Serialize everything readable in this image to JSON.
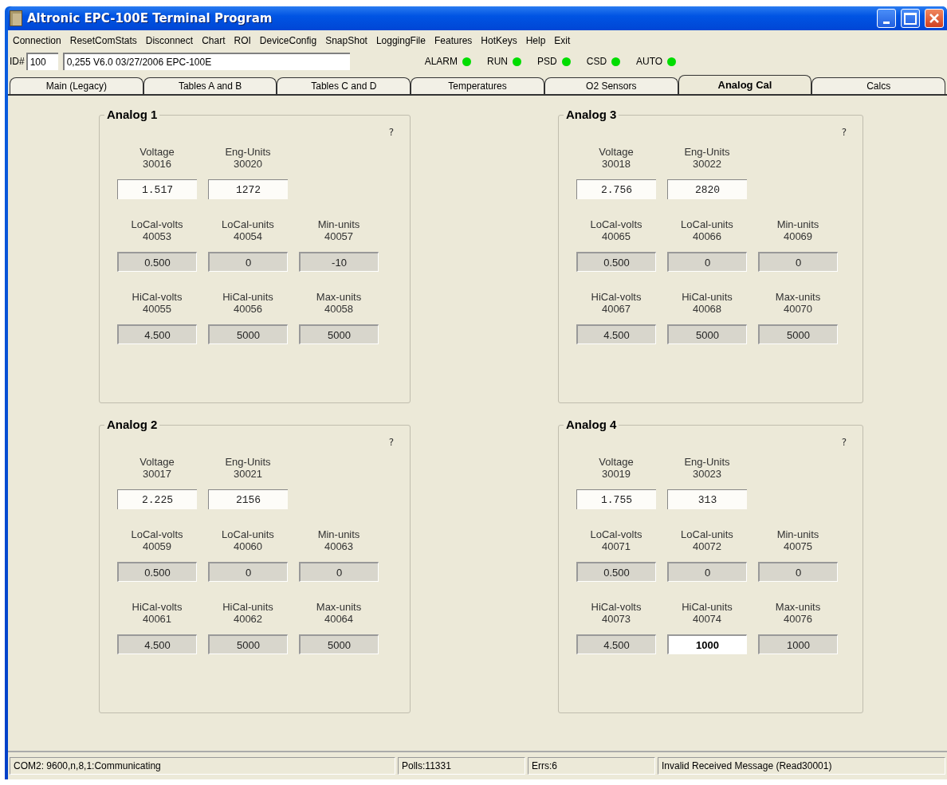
{
  "window": {
    "title": "Altronic EPC-100E Terminal Program"
  },
  "menu": [
    "Connection",
    "ResetComStats",
    "Disconnect",
    "Chart",
    "ROI",
    "DeviceConfig",
    "SnapShot",
    "LoggingFile",
    "Features",
    "HotKeys",
    "Help",
    "Exit"
  ],
  "id_row": {
    "label": "ID#",
    "id_value": "100",
    "device_info": "0,255 V6.0 03/27/2006 EPC-100E"
  },
  "indicators": [
    {
      "label": "ALARM",
      "on": true
    },
    {
      "label": "RUN",
      "on": true
    },
    {
      "label": "PSD",
      "on": true
    },
    {
      "label": "CSD",
      "on": true
    },
    {
      "label": "AUTO",
      "on": true
    }
  ],
  "tabs": [
    {
      "label": "Main (Legacy)",
      "selected": false
    },
    {
      "label": "Tables A and B",
      "selected": false
    },
    {
      "label": "Tables C and D",
      "selected": false
    },
    {
      "label": "Temperatures",
      "selected": false
    },
    {
      "label": "O2 Sensors",
      "selected": false
    },
    {
      "label": "Analog Cal",
      "selected": true
    },
    {
      "label": "Calcs",
      "selected": false
    }
  ],
  "groups": [
    {
      "title": "Analog 1",
      "help": "?",
      "readouts": [
        {
          "label": "Voltage",
          "register": "30016",
          "value": "1.517"
        },
        {
          "label": "Eng-Units",
          "register": "30020",
          "value": "1272"
        }
      ],
      "settings": [
        [
          {
            "label": "LoCal-volts",
            "register": "40053",
            "value": "0.500",
            "focused": false
          },
          {
            "label": "LoCal-units",
            "register": "40054",
            "value": "0",
            "focused": false
          },
          {
            "label": "Min-units",
            "register": "40057",
            "value": "-10",
            "focused": false
          }
        ],
        [
          {
            "label": "HiCal-volts",
            "register": "40055",
            "value": "4.500",
            "focused": false
          },
          {
            "label": "HiCal-units",
            "register": "40056",
            "value": "5000",
            "focused": false
          },
          {
            "label": "Max-units",
            "register": "40058",
            "value": "5000",
            "focused": false
          }
        ]
      ]
    },
    {
      "title": "Analog 3",
      "help": "?",
      "readouts": [
        {
          "label": "Voltage",
          "register": "30018",
          "value": "2.756"
        },
        {
          "label": "Eng-Units",
          "register": "30022",
          "value": "2820"
        }
      ],
      "settings": [
        [
          {
            "label": "LoCal-volts",
            "register": "40065",
            "value": "0.500",
            "focused": false
          },
          {
            "label": "LoCal-units",
            "register": "40066",
            "value": "0",
            "focused": false
          },
          {
            "label": "Min-units",
            "register": "40069",
            "value": "0",
            "focused": false
          }
        ],
        [
          {
            "label": "HiCal-volts",
            "register": "40067",
            "value": "4.500",
            "focused": false
          },
          {
            "label": "HiCal-units",
            "register": "40068",
            "value": "5000",
            "focused": false
          },
          {
            "label": "Max-units",
            "register": "40070",
            "value": "5000",
            "focused": false
          }
        ]
      ]
    },
    {
      "title": "Analog 2",
      "help": "?",
      "readouts": [
        {
          "label": "Voltage",
          "register": "30017",
          "value": "2.225"
        },
        {
          "label": "Eng-Units",
          "register": "30021",
          "value": "2156"
        }
      ],
      "settings": [
        [
          {
            "label": "LoCal-volts",
            "register": "40059",
            "value": "0.500",
            "focused": false
          },
          {
            "label": "LoCal-units",
            "register": "40060",
            "value": "0",
            "focused": false
          },
          {
            "label": "Min-units",
            "register": "40063",
            "value": "0",
            "focused": false
          }
        ],
        [
          {
            "label": "HiCal-volts",
            "register": "40061",
            "value": "4.500",
            "focused": false
          },
          {
            "label": "HiCal-units",
            "register": "40062",
            "value": "5000",
            "focused": false
          },
          {
            "label": "Max-units",
            "register": "40064",
            "value": "5000",
            "focused": false
          }
        ]
      ]
    },
    {
      "title": "Analog 4",
      "help": "?",
      "readouts": [
        {
          "label": "Voltage",
          "register": "30019",
          "value": "1.755"
        },
        {
          "label": "Eng-Units",
          "register": "30023",
          "value": "313"
        }
      ],
      "settings": [
        [
          {
            "label": "LoCal-volts",
            "register": "40071",
            "value": "0.500",
            "focused": false
          },
          {
            "label": "LoCal-units",
            "register": "40072",
            "value": "0",
            "focused": false
          },
          {
            "label": "Min-units",
            "register": "40075",
            "value": "0",
            "focused": false
          }
        ],
        [
          {
            "label": "HiCal-volts",
            "register": "40073",
            "value": "4.500",
            "focused": false
          },
          {
            "label": "HiCal-units",
            "register": "40074",
            "value": "1000",
            "focused": true
          },
          {
            "label": "Max-units",
            "register": "40076",
            "value": "1000",
            "focused": false
          }
        ]
      ]
    }
  ],
  "status_bar": {
    "connection": "COM2: 9600,n,8,1:Communicating",
    "polls": "Polls:11331",
    "errors": "Errs:6",
    "message": "Invalid Received Message (Read30001)"
  }
}
